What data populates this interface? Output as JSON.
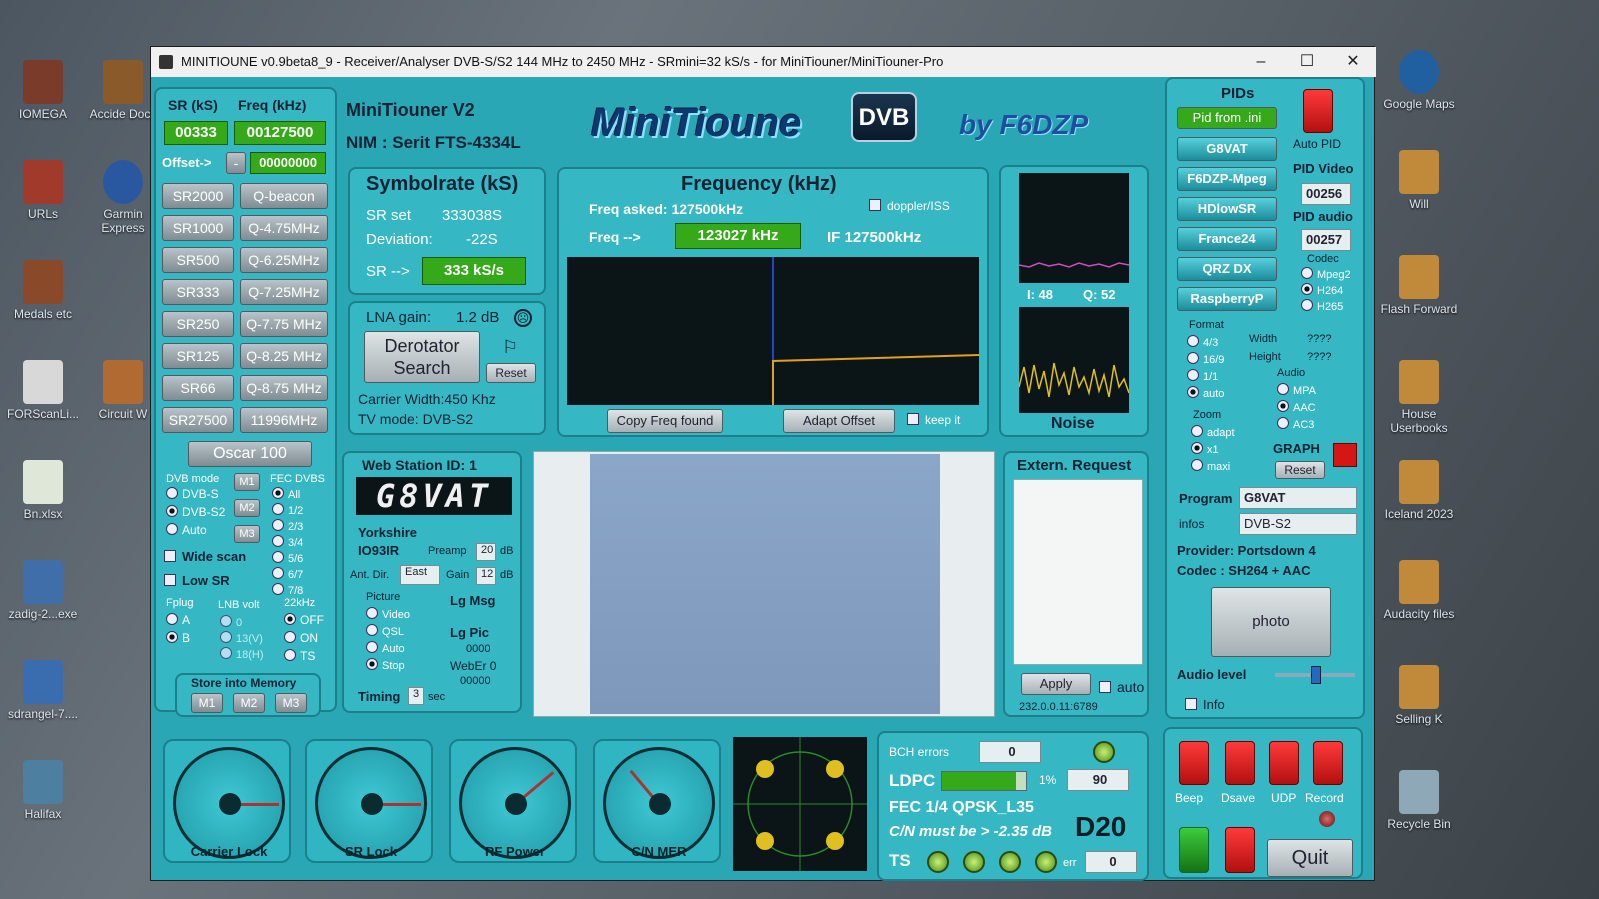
{
  "desktop": {
    "icons_left": [
      "IOMEGA",
      "Accide Docs",
      "URLs",
      "Garmin Express",
      "Medals etc",
      "FORScanLi...",
      "Circuit W",
      "Bn.xlsx",
      "zadig-2...exe",
      "sdrangel-7....",
      "Halifax"
    ],
    "icons_right": [
      "Google Maps",
      "Will",
      "Flash Forward",
      "House Userbooks",
      "Iceland 2023",
      "Audacity files",
      "Selling K",
      "Recycle Bin"
    ]
  },
  "window": {
    "title": "MINITIOUNE v0.9beta8_9 - Receiver/Analyser DVB-S/S2 144 MHz to 2450 MHz - SRmini=32 kS/s - for MiniTiouner/MiniTiouner-Pro",
    "minimize": "–",
    "maximize": "☐",
    "close": "✕"
  },
  "left": {
    "sr_label": "SR (kS)",
    "freq_label": "Freq (kHz)",
    "sr_value": "00333",
    "freq_value": "00127500",
    "offset_label": "Offset->",
    "offset_sign": "-",
    "offset_value": "00000000",
    "sr_buttons": [
      "SR2000",
      "SR1000",
      "SR500",
      "SR333",
      "SR250",
      "SR125",
      "SR66",
      "SR27500"
    ],
    "freq_buttons": [
      "Q-beacon",
      "Q-4.75MHz",
      "Q-6.25MHz",
      "Q-7.25MHz",
      "Q-7.75 MHz",
      "Q-8.25 MHz",
      "Q-8.75 MHz",
      "11996MHz"
    ],
    "oscar": "Oscar 100",
    "dvb_mode_label": "DVB mode",
    "dvb_modes": [
      "DVB-S",
      "DVB-S2",
      "Auto"
    ],
    "mem_small": [
      "M1",
      "M2",
      "M3"
    ],
    "fec_label": "FEC DVBS",
    "fec_options": [
      "All",
      "1/2",
      "2/3",
      "3/4",
      "5/6",
      "6/7",
      "7/8"
    ],
    "wide_scan": "Wide scan",
    "low_sr": "Low SR",
    "fplug_label": "Fplug",
    "fplug": [
      "A",
      "B"
    ],
    "lnb_label": "LNB volt",
    "lnb": [
      "0",
      "13(V)",
      "18(H)"
    ],
    "khz_label": "22kHz",
    "khz": [
      "OFF",
      "ON",
      "TS"
    ],
    "store_label": "Store into Memory",
    "store_buttons": [
      "M1",
      "M2",
      "M3"
    ]
  },
  "header": {
    "model": "MiniTiouner V2",
    "nim": "NIM : Serit FTS-4334L",
    "logo": "MiniTioune",
    "logo_badge": "DVB",
    "byline": "by F6DZP"
  },
  "symbolrate": {
    "title": "Symbolrate (kS)",
    "sr_set_label": "SR set",
    "sr_set": "333038S",
    "dev_label": "Deviation:",
    "dev": "-22S",
    "sr_arrow": "SR -->",
    "sr_value": "333 kS/s"
  },
  "lna": {
    "label": "LNA gain:",
    "value": "1.2 dB",
    "derot": "Derotator Search",
    "reset": "Reset",
    "carrier": "Carrier Width:450 Khz",
    "tvmode": "TV mode: DVB-S2"
  },
  "frequency": {
    "title": "Frequency (kHz)",
    "asked": "Freq asked: 127500kHz",
    "doppler": "doppler/ISS",
    "freq_arrow": "Freq -->",
    "freq_value": "123027 kHz",
    "if": "IF  127500kHz",
    "copy": "Copy Freq found",
    "adapt": "Adapt Offset",
    "keep": "keep it"
  },
  "iq": {
    "i_label": "I: 48",
    "q_label": "Q: 52",
    "noise": "Noise"
  },
  "webstation": {
    "title": "Web Station ID: 1",
    "callsign": "G8VAT",
    "location": "Yorkshire",
    "locator": "IO93IR",
    "preamp_label": "Preamp",
    "preamp": "20",
    "db1": "dB",
    "antdir_label": "Ant. Dir.",
    "antdir": "East",
    "gain_label": "Gain",
    "gain": "12",
    "db2": "dB",
    "picture_label": "Picture",
    "picture_opts": [
      "Video",
      "QSL",
      "Auto",
      "Stop"
    ],
    "lgmsg": "Lg Msg",
    "lgpic": "Lg Pic",
    "zeros": "0000",
    "weber": "WebEr 0",
    "weber_val": "00000",
    "timing_label": "Timing",
    "timing": "3",
    "sec": "sec"
  },
  "extern": {
    "title": "Extern. Request",
    "apply": "Apply",
    "auto": "auto",
    "ip": "232.0.0.11:6789"
  },
  "pids": {
    "title": "PIDs",
    "from_ini": "Pid from .ini",
    "auto_pid": "Auto PID",
    "buttons": [
      "G8VAT",
      "F6DZP-Mpeg",
      "HDlowSR",
      "France24",
      "QRZ DX",
      "RaspberryP"
    ],
    "pid_video_label": "PID Video",
    "pid_video": "00256",
    "pid_audio_label": "PID audio",
    "pid_audio": "00257",
    "codec_label": "Codec",
    "codecs": [
      "Mpeg2",
      "H264",
      "H265"
    ],
    "format_label": "Format",
    "formats": [
      "4/3",
      "16/9",
      "1/1",
      "auto"
    ],
    "width_label": "Width",
    "width": "????",
    "height_label": "Height",
    "height": "????",
    "audio_label": "Audio",
    "audios": [
      "MPA",
      "AAC",
      "AC3"
    ],
    "zoom_label": "Zoom",
    "zooms": [
      "adapt",
      "x1",
      "maxi"
    ],
    "graph": "GRAPH",
    "reset": "Reset",
    "program_label": "Program",
    "program": "G8VAT",
    "infos_label": "infos",
    "infos": "DVB-S2",
    "provider": "Provider: Portsdown 4",
    "codec": "Codec :   SH264 + AAC",
    "photo": "photo",
    "audio_level": "Audio level",
    "info": "Info"
  },
  "gauges": [
    "Carrier Lock",
    "SR Lock",
    "RF Power",
    "C/N MER"
  ],
  "status": {
    "bch_label": "BCH errors",
    "bch": "0",
    "ldpc_label": "LDPC",
    "ldpc_pct": "1%",
    "ldpc_val": "90",
    "fec": "FEC  1/4 QPSK_L35",
    "cn": "C/N must be > -2.35 dB",
    "dcode": "D20",
    "ts": "TS",
    "err_label": "err",
    "err": "0"
  },
  "controls": {
    "labels": [
      "Beep",
      "Dsave",
      "UDP",
      "Record"
    ],
    "quit": "Quit"
  }
}
